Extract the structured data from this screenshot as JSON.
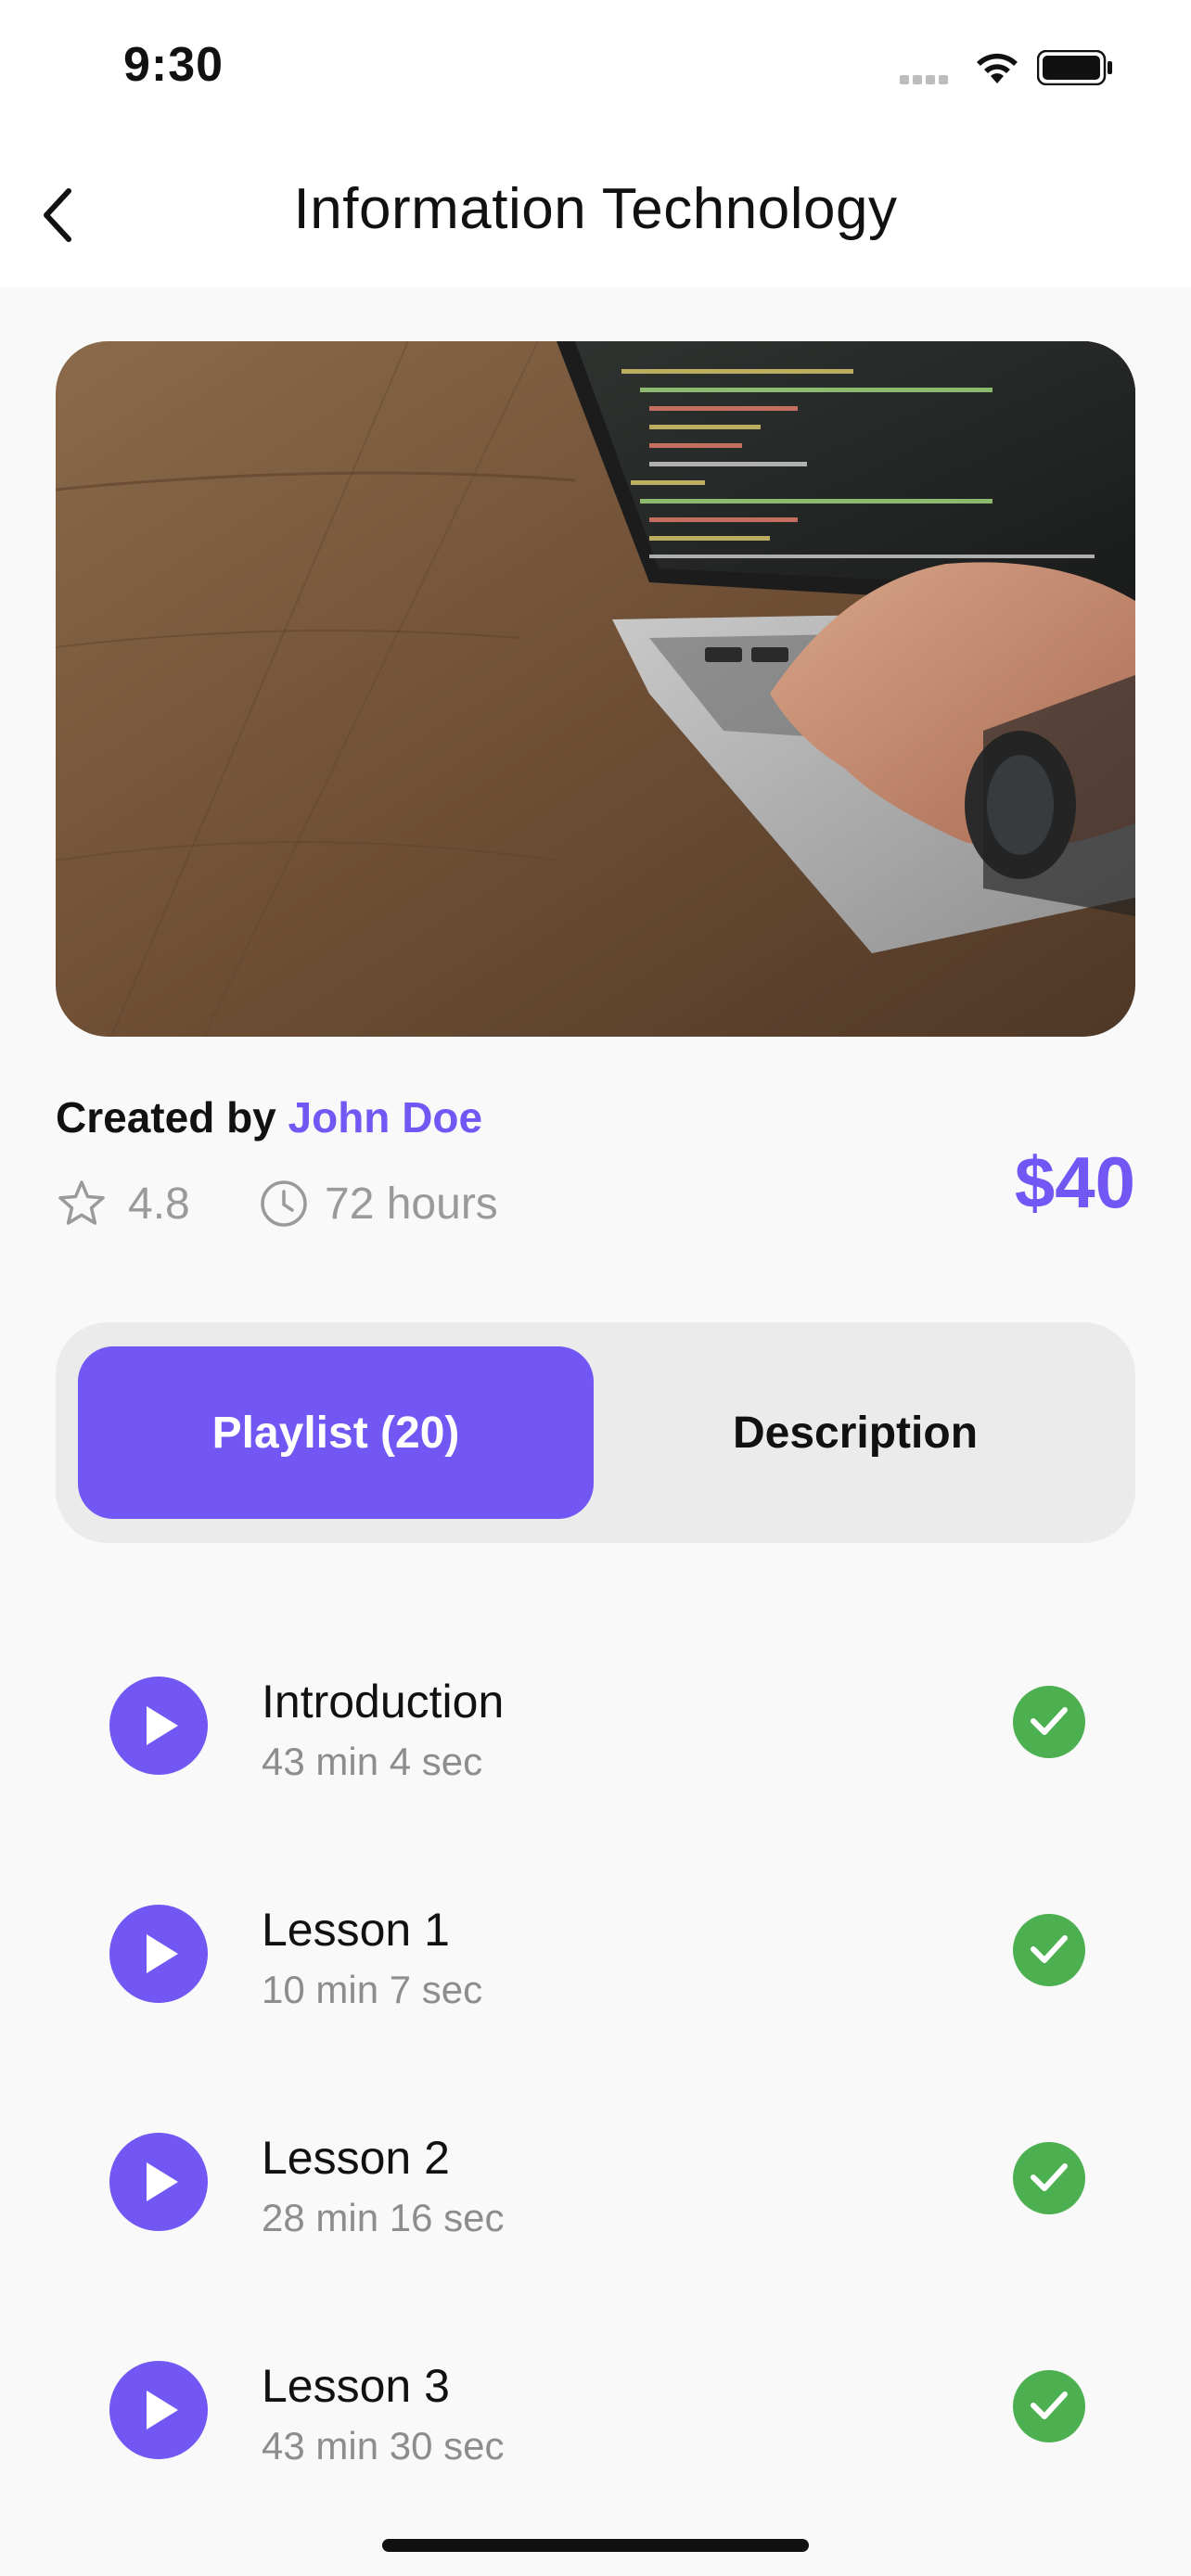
{
  "status_bar": {
    "time": "9:30"
  },
  "header": {
    "title": "Information Technology",
    "back_icon": "chevron-left-icon"
  },
  "course": {
    "created_by_label": "Created by",
    "author": "John Doe",
    "rating": "4.8",
    "duration": "72 hours",
    "price": "$40"
  },
  "tabs": [
    {
      "label": "Playlist (20)",
      "active": true
    },
    {
      "label": "Description",
      "active": false
    }
  ],
  "lessons": [
    {
      "title": "Introduction",
      "duration": "43 min 4 sec",
      "completed": true
    },
    {
      "title": "Lesson 1",
      "duration": "10 min 7 sec",
      "completed": true
    },
    {
      "title": "Lesson 2",
      "duration": "28 min 16 sec",
      "completed": true
    },
    {
      "title": "Lesson 3",
      "duration": "43 min 30 sec",
      "completed": true
    }
  ],
  "colors": {
    "accent": "#7257f5",
    "success": "#4caf50",
    "muted": "#9a9a9a"
  }
}
